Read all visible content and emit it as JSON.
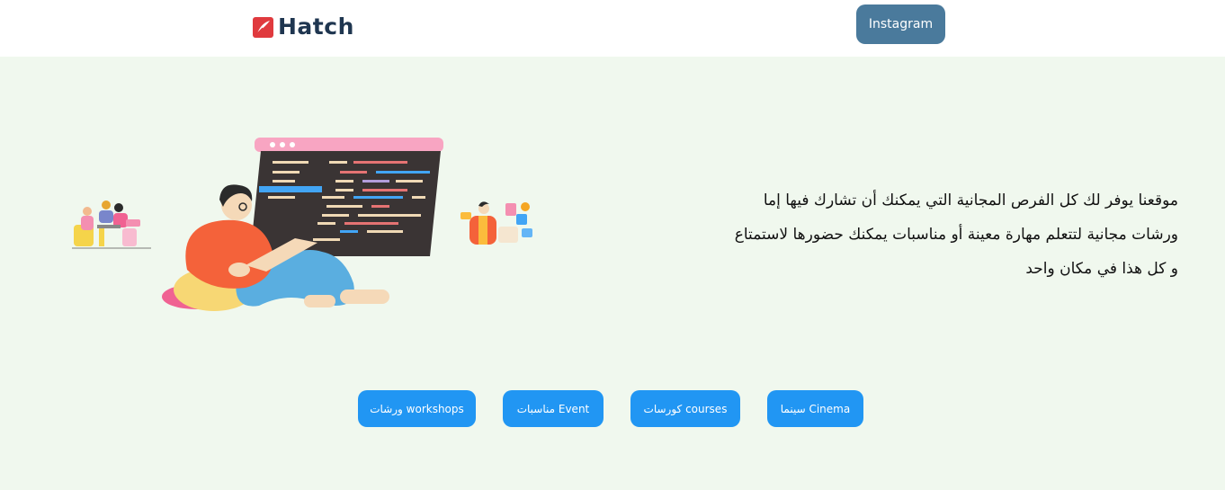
{
  "header": {
    "logo_text": "Hatch",
    "logo_icon": "feather-logo-icon",
    "instagram_label": "Instagram",
    "instagram_color": "#4a7a9c"
  },
  "intro": {
    "line1": "موقعنا يوفر لك كل الفرص المجانية التي يمكنك أن تشارك فيها إما",
    "line2": "ورشات مجانية لتتعلم مهارة معينة أو مناسبات يمكنك حضورها لاستمتاع",
    "line3": "و كل هذا في مكان واحد"
  },
  "categories": [
    {
      "label": "سينما Cinema"
    },
    {
      "label": "كورسات courses"
    },
    {
      "label": "مناسبات Event"
    },
    {
      "label": "ورشات workshops"
    }
  ],
  "colors": {
    "page_bg": "#f0f8ee",
    "category_button": "#2196f3",
    "logo_text": "#1f3650",
    "logo_accent": "#e03a3e"
  }
}
